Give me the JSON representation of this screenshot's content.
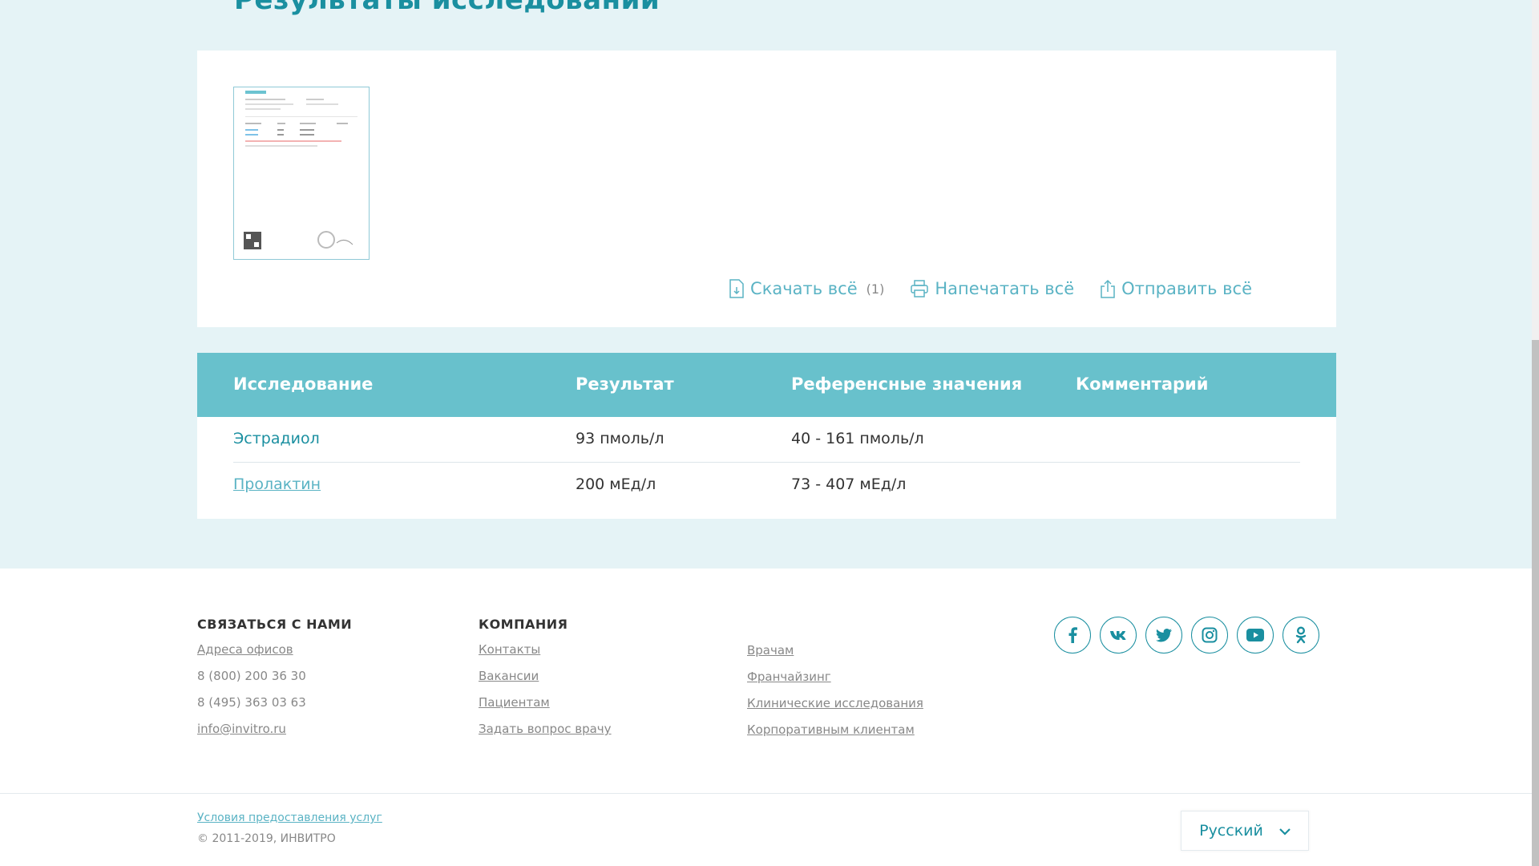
{
  "page": {
    "title": "Результаты исследований"
  },
  "document_panel": {
    "actions": [
      {
        "label": "Скачать всё",
        "count": "(1)",
        "icon": "download-file-icon"
      },
      {
        "label": "Напечатать всё",
        "icon": "printer-icon"
      },
      {
        "label": "Отправить всё",
        "icon": "share-icon"
      }
    ]
  },
  "results_table": {
    "headers": [
      "Исследование",
      "Результат",
      "Референсные значения",
      "Комментарий"
    ],
    "rows": [
      {
        "test": "Эстрадиол",
        "result": "93 пмоль/л",
        "reference": "40 - 161 пмоль/л",
        "comment": ""
      },
      {
        "test": "Пролактин",
        "result": "200 мЕд/л",
        "reference": "73 - 407 мЕд/л",
        "comment": ""
      }
    ]
  },
  "footer": {
    "contact": {
      "heading": "СВЯЗАТЬСЯ С НАМИ",
      "items": [
        "Адреса офисов",
        "8 (800) 200 36 30",
        "8 (495) 363 03 63",
        "info@invitro.ru"
      ]
    },
    "company": {
      "heading": "КОМПАНИЯ",
      "col1": [
        "Контакты",
        "Вакансии",
        "Пациентам",
        "Задать вопрос врачу"
      ],
      "col2": [
        "Врачам",
        "Франчайзинг",
        "Клинические исследования",
        "Корпоративным клиентам"
      ]
    },
    "socials": [
      "facebook-icon",
      "vk-icon",
      "twitter-icon",
      "instagram-icon",
      "youtube-icon",
      "odnoklassniki-icon"
    ],
    "terms": "Условия предоставления услуг",
    "copyright": "© 2011-2019, ИНВИТРО",
    "language": "Русский"
  },
  "colors": {
    "accent": "#1a8fa0",
    "table_header": "#68c1cc",
    "background": "#e5f3f6"
  }
}
